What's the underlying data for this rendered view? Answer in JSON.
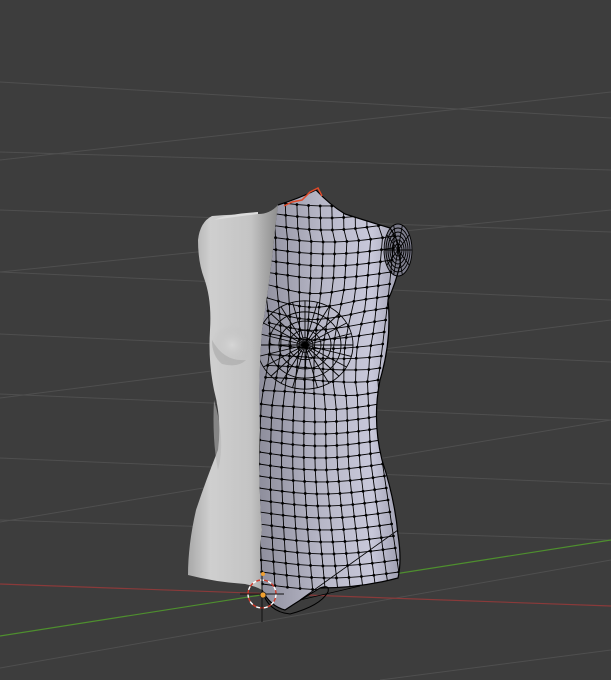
{
  "viewport": {
    "background_color": "#3d3d3d",
    "grid_color": "#4f4f4f",
    "x_axis_color": "#8a3a3a",
    "y_axis_color": "#4e8f2e",
    "wire_color": "#000000",
    "selected_edge_color": "#e04a2a"
  },
  "object": {
    "type": "mannequin-torso",
    "mode": "edit",
    "modifier": "mirror"
  },
  "icons": {
    "cursor": "3d-cursor-icon",
    "origin": "object-origin-icon"
  }
}
